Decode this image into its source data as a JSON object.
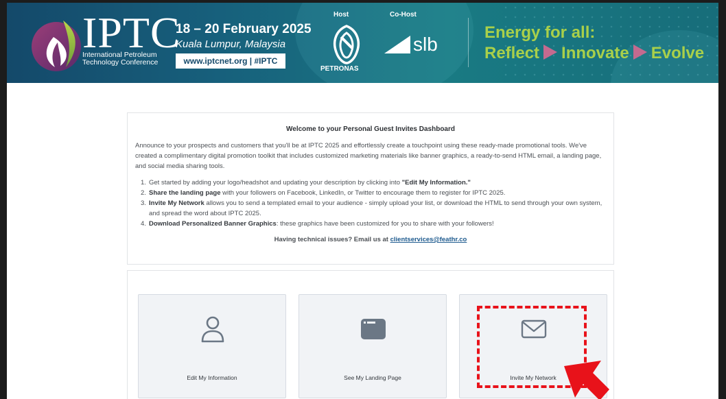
{
  "banner": {
    "logo_text": "IPTC",
    "logo_sub1": "International Petroleum",
    "logo_sub2": "Technology Conference",
    "event_dates": "18 – 20 February 2025",
    "event_city": "Kuala Lumpur, Malaysia",
    "event_web": "www.iptcnet.org | #IPTC",
    "host_label": "Host",
    "host_name": "PETRONAS",
    "cohost_label": "Co-Host",
    "tagline_line1": "Energy for all:",
    "tagline_words": [
      "Reflect",
      "Innovate",
      "Evolve"
    ],
    "colors": {
      "tagline": "#a9d04a",
      "arrow": "#c46a8f",
      "banner_start": "#14496a",
      "banner_end": "#197a83"
    }
  },
  "welcome": {
    "title": "Welcome to your Personal Guest Invites Dashboard",
    "intro": "Announce to your prospects and customers that you'll be at IPTC 2025 and effortlessly create a touchpoint using these ready-made promotional tools. We've created a complimentary digital promotion toolkit that includes customized marketing materials like banner graphics, a ready-to-send HTML email, a landing page, and social media sharing tools.",
    "steps": [
      {
        "num": "1.",
        "pre": "Get started by adding your logo/headshot and updating your description by clicking into ",
        "bold": "\"Edit My Information.\"",
        "post": ""
      },
      {
        "num": "2.",
        "pre": "",
        "bold": "Share the landing page",
        "post": " with your followers on Facebook, LinkedIn, or Twitter to encourage them to register for IPTC 2025."
      },
      {
        "num": "3.",
        "pre": "",
        "bold": "Invite My Network",
        "post": " allows you to send a templated email to your audience - simply upload your list, or download the HTML to send through your own system, and spread the word about IPTC 2025."
      },
      {
        "num": "4.",
        "pre": "",
        "bold": "Download Personalized Banner Graphics",
        "post": ": these graphics have been customized for you to share with your followers!"
      }
    ],
    "support_text": "Having technical issues? Email us at ",
    "support_email": "clientservices@feathr.co"
  },
  "tiles": [
    {
      "label": "Edit My Information",
      "icon": "user-icon"
    },
    {
      "label": "See My Landing Page",
      "icon": "browser-window-icon"
    },
    {
      "label": "Invite My Network",
      "icon": "envelope-icon"
    }
  ],
  "annotation": {
    "color": "#e8121a",
    "target": "Invite My Network"
  }
}
